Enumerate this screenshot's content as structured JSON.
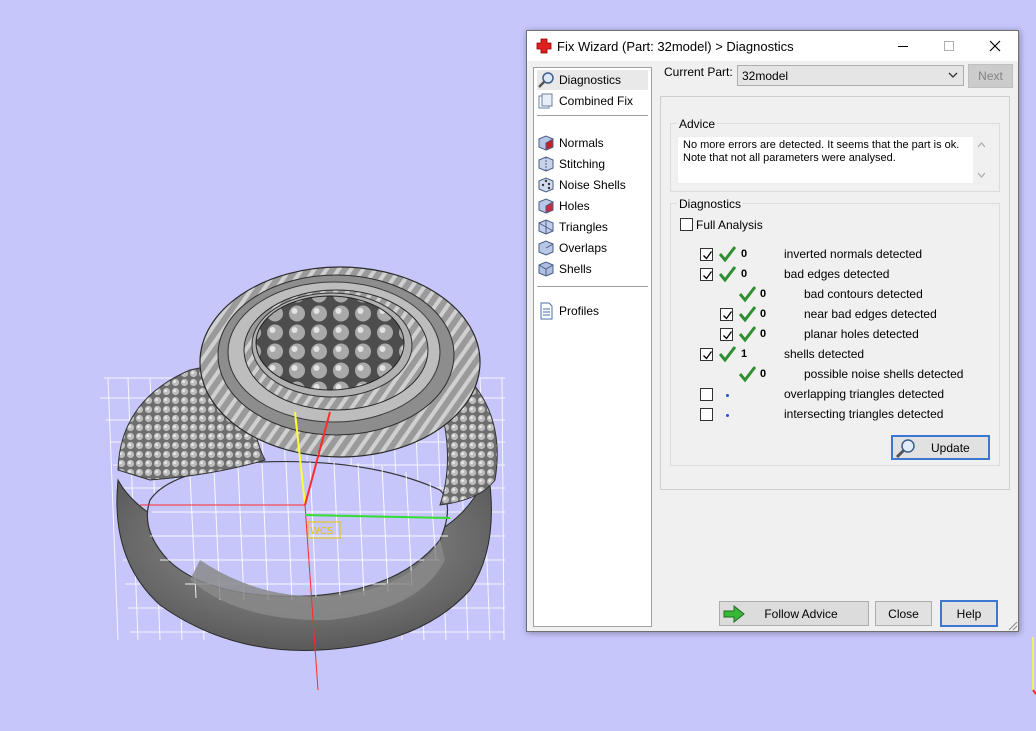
{
  "window": {
    "title": "Fix Wizard (Part: 32model) > Diagnostics",
    "controls": {
      "minimize": "minimize-icon",
      "maximize": "maximize-icon",
      "close": "close-icon"
    }
  },
  "nav": {
    "items": [
      {
        "label": "Diagnostics",
        "icon": "magnifier-icon",
        "selected": true
      },
      {
        "label": "Combined Fix",
        "icon": "pages-icon"
      },
      {
        "label": "Normals",
        "icon": "cube-red-icon"
      },
      {
        "label": "Stitching",
        "icon": "cube-stitch-icon"
      },
      {
        "label": "Noise Shells",
        "icon": "dice-icon"
      },
      {
        "label": "Holes",
        "icon": "cube-hole-icon"
      },
      {
        "label": "Triangles",
        "icon": "cube-triangle-icon"
      },
      {
        "label": "Overlaps",
        "icon": "cube-overlap-icon"
      },
      {
        "label": "Shells",
        "icon": "cube-shell-icon"
      },
      {
        "label": "Profiles",
        "icon": "document-icon"
      }
    ]
  },
  "current_part": {
    "label": "Current Part:",
    "value": "32model",
    "next_label": "Next"
  },
  "advice": {
    "caption": "Advice",
    "line1": "No more errors are detected. It seems that the part is ok.",
    "line2": "Note that not all parameters were analysed."
  },
  "diagnostics": {
    "caption": "Diagnostics",
    "full_analysis": {
      "label": "Full Analysis",
      "checked": false
    },
    "rows": [
      {
        "checked": true,
        "ok": true,
        "count": "0",
        "label": "inverted normals detected"
      },
      {
        "checked": true,
        "ok": true,
        "count": "0",
        "label": "bad edges detected"
      },
      {
        "ok": true,
        "count": "0",
        "label": "bad contours detected"
      },
      {
        "checked": true,
        "ok": true,
        "count": "0",
        "label": "near bad edges detected"
      },
      {
        "checked": true,
        "ok": true,
        "count": "0",
        "label": "planar holes detected"
      },
      {
        "checked": true,
        "ok": true,
        "count": "1",
        "label": "shells detected"
      },
      {
        "ok": true,
        "count": "0",
        "label": "possible noise shells detected"
      },
      {
        "checked": false,
        "label": "overlapping triangles detected"
      },
      {
        "checked": false,
        "label": "intersecting triangles detected"
      }
    ],
    "update_label": "Update"
  },
  "footer": {
    "follow_advice_label": "Follow Advice",
    "close_label": "Close",
    "help_label": "Help"
  },
  "viewport": {
    "background": "#c6c6fb",
    "axis_label": "WCS",
    "axis_colors": {
      "x": "#ff2a2a",
      "y": "#ffff33",
      "z": "#33dd33"
    }
  }
}
